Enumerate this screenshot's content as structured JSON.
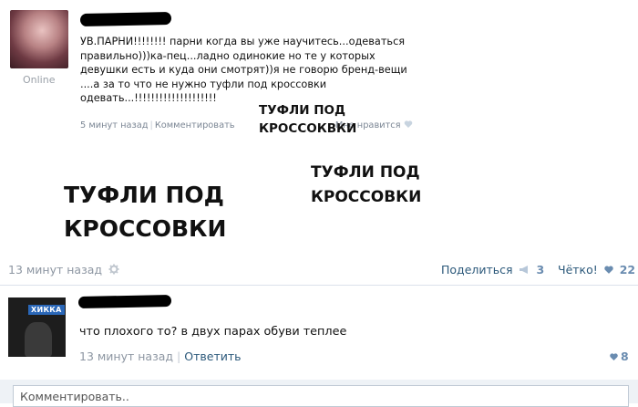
{
  "post": {
    "author_status": "Online",
    "text": "УВ.ПАРНИ!!!!!!!! парни когда вы уже научитесь...одеваться\nправильно)))ка-пец...ладно одинокие но те у которых\nдевушки есть и куда они смотрят))я не говорю бренд-вещи\n....а за то что не нужно туфли под кроссовки\nодевать...!!!!!!!!!!!!!!!!!!!!",
    "time": "5 минут назад",
    "comment_link": "Комментировать",
    "like_label": "Мне нравится",
    "captions": {
      "small": "ТУФЛИ ПОД\nКРОССОКВКИ",
      "mid": "ТУФЛИ ПОД\nКРОССОВКИ",
      "big": "ТУФЛИ ПОД\nКРОССОВКИ"
    }
  },
  "footer": {
    "time": "13 минут назад",
    "share_label": "Поделиться",
    "share_count": "3",
    "cool_label": "Чётко!",
    "cool_count": "22"
  },
  "comment": {
    "avatar_tag": "ХИККА",
    "text": "что плохого то? в двух парах обуви теплее",
    "time": "13 минут назад",
    "reply_label": "Ответить",
    "likes": "8"
  },
  "input": {
    "placeholder": "Комментировать.."
  },
  "colors": {
    "link": "#2b587a",
    "meta": "#8d96a2",
    "accent": "#6a8cb0"
  }
}
